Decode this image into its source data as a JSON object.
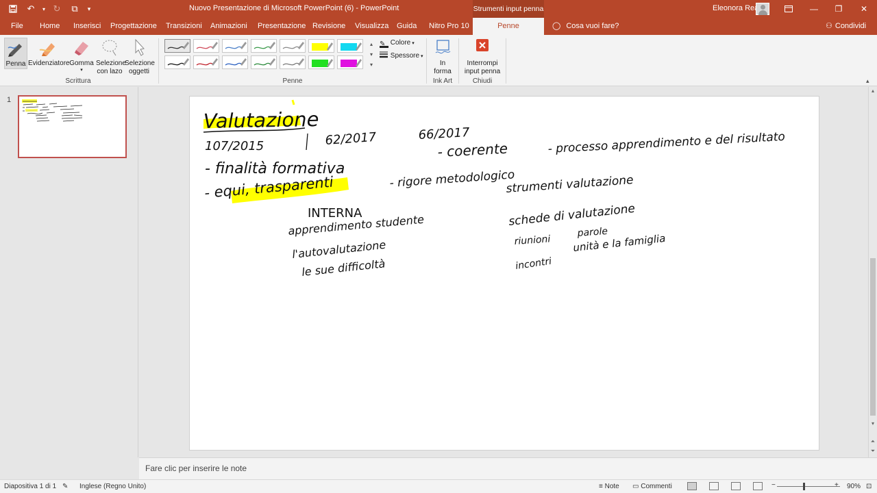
{
  "app": {
    "title": "Nuovo Presentazione di Microsoft PowerPoint (6)  -  PowerPoint",
    "context_tab_title": "Strumenti input penna",
    "user_name": "Eleonora Rea",
    "qat": {
      "save_icon": "save-icon",
      "undo_icon": "undo-icon",
      "redo_icon": "redo-icon",
      "present_icon": "start-from-beginning-icon",
      "customize_icon": "customize-qat-icon"
    },
    "accent_color": "#b7472a"
  },
  "tabs": [
    {
      "label": "File"
    },
    {
      "label": "Home"
    },
    {
      "label": "Inserisci"
    },
    {
      "label": "Progettazione"
    },
    {
      "label": "Transizioni"
    },
    {
      "label": "Animazioni"
    },
    {
      "label": "Presentazione"
    },
    {
      "label": "Revisione"
    },
    {
      "label": "Visualizza"
    },
    {
      "label": "Guida"
    },
    {
      "label": "Nitro Pro 10"
    },
    {
      "label": "Penne"
    }
  ],
  "tell_me": "Cosa vuoi fare?",
  "share": "Condividi",
  "ribbon": {
    "scrittura": {
      "label": "Scrittura",
      "penna": "Penna",
      "evidenziatore": "Evidenziatore",
      "gomma": "Gomma",
      "selezione_lazo_1": "Selezione",
      "selezione_lazo_2": "con lazo",
      "selezione_oggetti_1": "Selezione",
      "selezione_oggetti_2": "oggetti"
    },
    "penne": {
      "label": "Penne",
      "colore": "Colore",
      "spessore": "Spessore",
      "swatches": [
        {
          "color": "#333333",
          "kind": "pen"
        },
        {
          "color": "#d04a5a",
          "kind": "pen"
        },
        {
          "color": "#4a7fc8",
          "kind": "pen"
        },
        {
          "color": "#3a9a4a",
          "kind": "pen"
        },
        {
          "color": "#8a8a8a",
          "kind": "pen"
        },
        {
          "color": "#ffff00",
          "kind": "highlighter"
        },
        {
          "color": "#12d8f0",
          "kind": "highlighter"
        },
        {
          "color": "#111111",
          "kind": "pen"
        },
        {
          "color": "#c0202a",
          "kind": "pen"
        },
        {
          "color": "#2a5fc0",
          "kind": "pen"
        },
        {
          "color": "#2a8a3a",
          "kind": "pen"
        },
        {
          "color": "#7a7a7a",
          "kind": "pen"
        },
        {
          "color": "#22e022",
          "kind": "highlighter"
        },
        {
          "color": "#e010e0",
          "kind": "highlighter"
        }
      ]
    },
    "ink_art": {
      "label": "Ink Art",
      "btn_1": "In",
      "btn_2": "forma"
    },
    "chiudi": {
      "label": "Chiudi",
      "btn_1": "Interrompi",
      "btn_2": "input penna"
    }
  },
  "thumbnails": [
    {
      "number": "1"
    }
  ],
  "slide": {
    "title_ink": "Valutazione",
    "ink_lines": [
      "107/2015",
      "62/2017",
      "66/2017",
      "- finalità formativa",
      "- coerente",
      "- processo apprendimento e del risultato",
      "- equi, trasparenti",
      "- rigore metodologico",
      "strumenti valutazione",
      "INTERNA",
      "apprendimento studente",
      "l'autovalutazione",
      "le sue difficoltà",
      "schede di valutazione",
      "riunioni",
      "parole",
      "incontri",
      "unità e la famiglia"
    ]
  },
  "notes_placeholder": "Fare clic per inserire le note",
  "status": {
    "slide_info": "Diapositiva 1 di 1",
    "language": "Inglese (Regno Unito)",
    "notes": "Note",
    "comments": "Commenti",
    "zoom": "90%"
  }
}
